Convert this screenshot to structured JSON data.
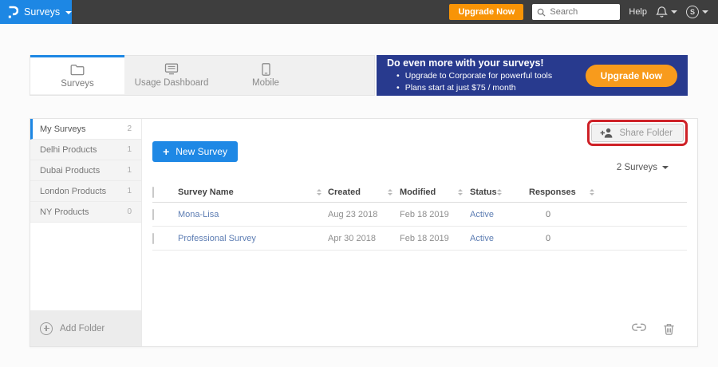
{
  "colors": {
    "brand_blue": "#1d87e4",
    "accent_orange": "#f89406",
    "banner_navy": "#283a8e",
    "link_blue": "#5d7db3",
    "annotation_red": "#ce2127"
  },
  "topbar": {
    "product_menu": "Surveys",
    "upgrade_label": "Upgrade Now",
    "search_placeholder": "Search",
    "help_label": "Help",
    "avatar_initial": "S"
  },
  "tabs": [
    {
      "label": "Surveys",
      "icon": "folder-icon",
      "active": true
    },
    {
      "label": "Usage Dashboard",
      "icon": "dashboard-icon",
      "active": false
    },
    {
      "label": "Mobile",
      "icon": "mobile-icon",
      "active": false
    }
  ],
  "banner": {
    "title": "Do even more with your surveys!",
    "bullets": [
      "Upgrade to Corporate for powerful tools",
      "Plans start at just $75 / month"
    ],
    "cta_label": "Upgrade Now"
  },
  "sidebar": {
    "folders": [
      {
        "name": "My Surveys",
        "count": "2",
        "active": true
      },
      {
        "name": "Delhi Products",
        "count": "1",
        "active": false
      },
      {
        "name": "Dubai Products",
        "count": "1",
        "active": false
      },
      {
        "name": "London Products",
        "count": "1",
        "active": false
      },
      {
        "name": "NY Products",
        "count": "0",
        "active": false
      }
    ],
    "add_folder_label": "Add Folder"
  },
  "toolbar": {
    "share_folder_label": "Share Folder",
    "new_survey_plus": "+",
    "new_survey_label": "New Survey",
    "surveys_count_label": "2 Surveys"
  },
  "table": {
    "headers": [
      "Survey Name",
      "Created",
      "Modified",
      "Status",
      "Responses"
    ],
    "rows": [
      {
        "name": "Mona-Lisa",
        "created": "Aug 23 2018",
        "modified": "Feb 18 2019",
        "status": "Active",
        "responses": "0"
      },
      {
        "name": "Professional Survey",
        "created": "Apr 30 2018",
        "modified": "Feb 18 2019",
        "status": "Active",
        "responses": "0"
      }
    ]
  }
}
